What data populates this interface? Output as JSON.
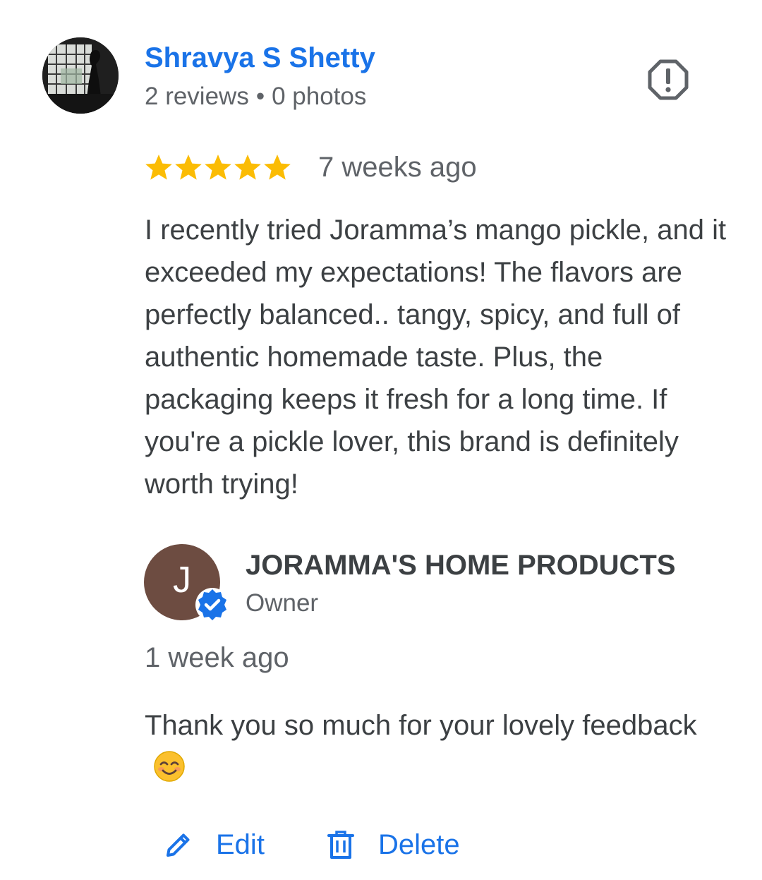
{
  "reviewer": {
    "name": "Shravya S Shetty",
    "reviews": "2 reviews",
    "separator": "•",
    "photos": "0 photos"
  },
  "review": {
    "rating": 5,
    "max_rating": 5,
    "date": "7 weeks ago",
    "text": "I recently tried Joramma’s mango pickle, and it exceeded my expectations! The flavors are perfectly balanced.. tangy, spicy, and full of authentic homemade taste. Plus, the packaging keeps it fresh for a long time. If you're a pickle lover, this brand is definitely worth trying!"
  },
  "owner_response": {
    "avatar_initial": "J",
    "name": "JORAMMA'S HOME PRODUCTS",
    "role": "Owner",
    "date": "1 week ago",
    "text": "Thank you so much for your lovely feedback",
    "emoji": "smiling-face-with-smiling-eyes"
  },
  "actions": {
    "edit_label": "Edit",
    "delete_label": "Delete"
  },
  "icons": {
    "report": "report-icon",
    "star": "star-icon",
    "verified": "verified-badge-icon",
    "edit": "pencil-icon",
    "delete": "trash-icon"
  },
  "colors": {
    "link_blue": "#1a73e8",
    "star_gold": "#fbbc04",
    "text_primary": "#3c4043",
    "text_secondary": "#5f6368",
    "owner_avatar_bg": "#6d4c41",
    "verified_blue": "#1a73e8"
  }
}
